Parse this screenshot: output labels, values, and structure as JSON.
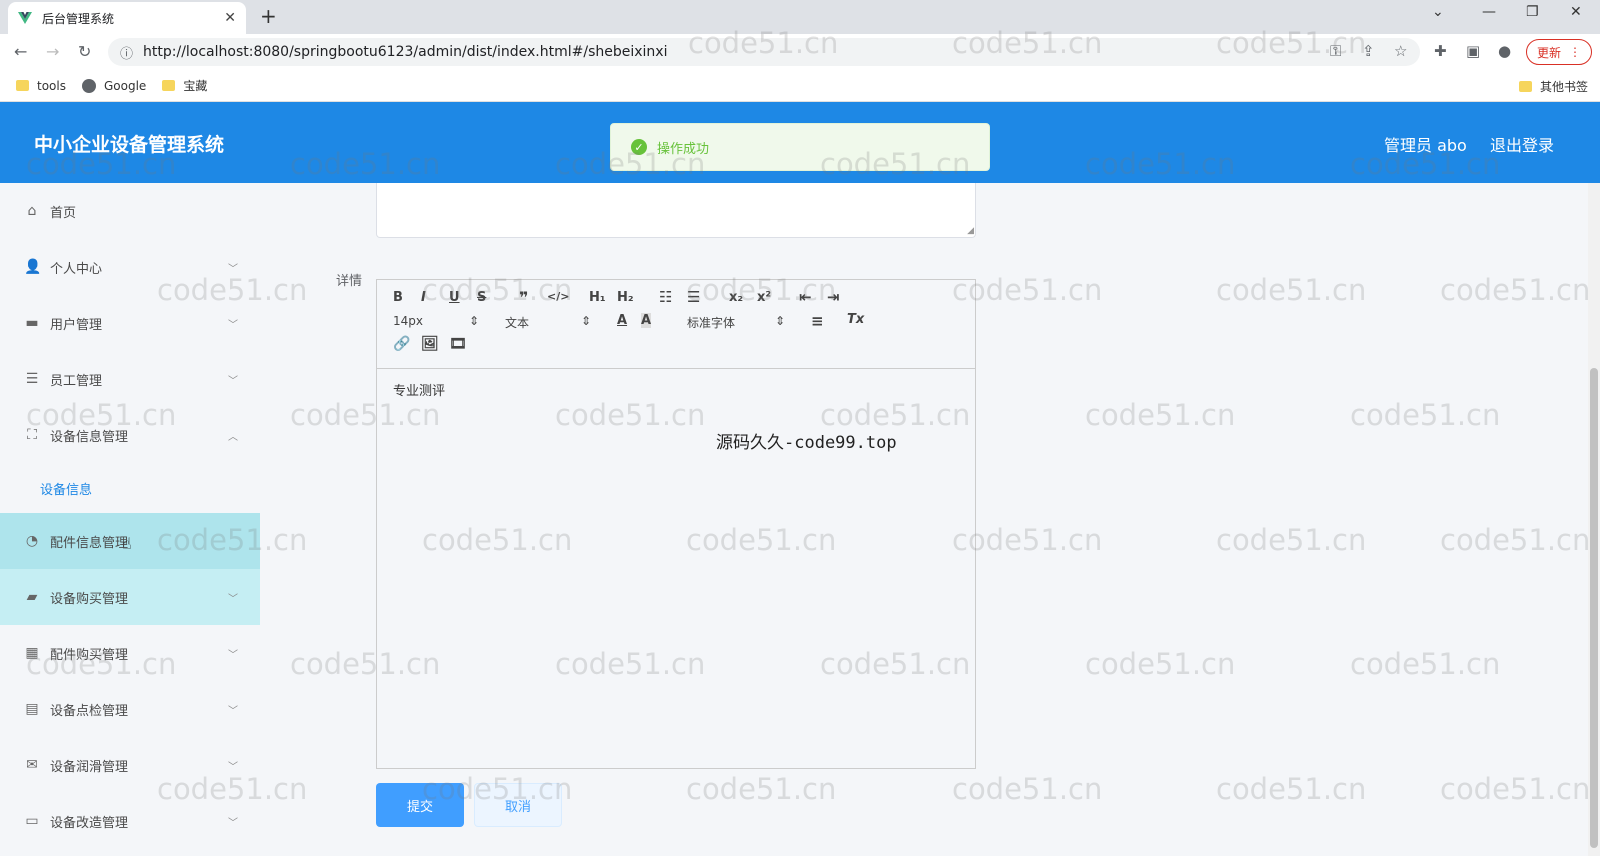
{
  "browser": {
    "tab_title": "后台管理系统",
    "tab_close": "✕",
    "new_tab": "+",
    "url": "http://localhost:8080/springbootu6123/admin/dist/index.html#/shebeixinxi",
    "update_label": "更新",
    "bookmarks": [
      {
        "label": "tools",
        "icon": "folder-icon"
      },
      {
        "label": "Google",
        "icon": "globe-icon"
      },
      {
        "label": "宝藏",
        "icon": "folder-icon"
      }
    ],
    "other_bookmarks": "其他书签"
  },
  "header": {
    "title": "中小企业设备管理系统",
    "user": "管理员 abo",
    "logout": "退出登录"
  },
  "toast": {
    "message": "操作成功",
    "color": "#67c23a"
  },
  "sidebar": {
    "items": [
      {
        "label": "首页",
        "icon": "home-icon"
      },
      {
        "label": "个人中心",
        "icon": "user-icon"
      },
      {
        "label": "用户管理",
        "icon": "briefcase-icon"
      },
      {
        "label": "员工管理",
        "icon": "list-icon"
      },
      {
        "label": "设备信息管理",
        "icon": "fullscreen-icon"
      },
      {
        "label": "配件信息管理",
        "icon": "dashboard-icon"
      },
      {
        "label": "设备购买管理",
        "icon": "ticket-icon"
      },
      {
        "label": "配件购买管理",
        "icon": "grid-icon"
      },
      {
        "label": "设备点检管理",
        "icon": "clipboard-icon"
      },
      {
        "label": "设备润滑管理",
        "icon": "mail-icon"
      },
      {
        "label": "设备改造管理",
        "icon": "form-icon"
      }
    ],
    "sub_item": "设备信息"
  },
  "form": {
    "detail_label": "详情",
    "toolbar": {
      "font_size": "14px",
      "block": "文本",
      "font_family": "标准字体"
    },
    "content": "专业测评",
    "submit": "提交",
    "cancel": "取消"
  },
  "overlay_text": "源码久久-code99.top",
  "watermark": "code51.cn",
  "colors": {
    "header_bg": "#1e88e5",
    "accent": "#409eff",
    "active_menu_bg": "#aee4ec"
  }
}
